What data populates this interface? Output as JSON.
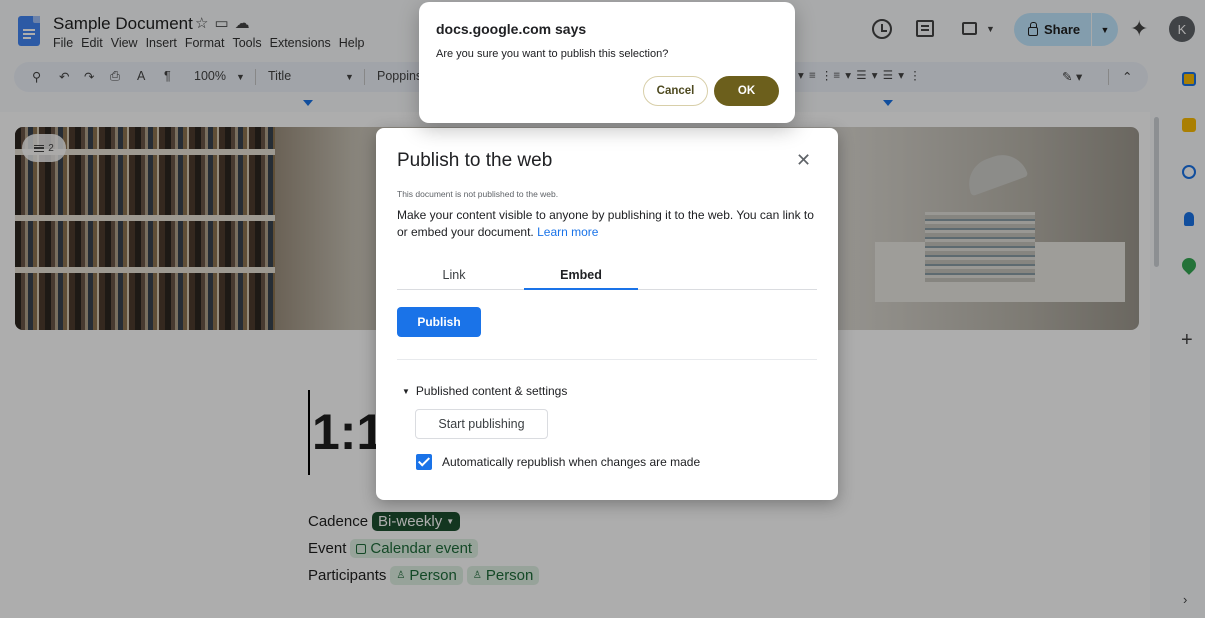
{
  "header": {
    "doc_title": "Sample Document",
    "menu": [
      "File",
      "Edit",
      "View",
      "Insert",
      "Format",
      "Tools",
      "Extensions",
      "Help"
    ],
    "share_label": "Share",
    "avatar_initial": "K"
  },
  "toolbar": {
    "zoom": "100%",
    "style": "Title",
    "font": "Poppins"
  },
  "document": {
    "outline_count": "2",
    "heading": "1:1",
    "cadence_label": "Cadence",
    "cadence_value": "Bi-weekly",
    "event_label": "Event",
    "event_value": "Calendar event",
    "participants_label": "Participants",
    "participants": [
      "Person",
      "Person"
    ]
  },
  "publish_dialog": {
    "title": "Publish to the web",
    "status": "This document is not published to the web.",
    "description": "Make your content visible to anyone by publishing it to the web. You can link to or embed your document.",
    "learn_more": "Learn more",
    "tabs": [
      "Link",
      "Embed"
    ],
    "active_tab": "Embed",
    "publish_button": "Publish",
    "section_title": "Published content & settings",
    "start_publishing": "Start publishing",
    "auto_republish": "Automatically republish when changes are made",
    "auto_republish_checked": true
  },
  "alert": {
    "title": "docs.google.com says",
    "message": "Are you sure you want to publish this selection?",
    "cancel": "Cancel",
    "ok": "OK"
  },
  "colors": {
    "accent": "#1a73e8",
    "share_bg": "#c2e7ff",
    "ok_button": "#6c5f1c",
    "chip_bg": "#dff0e3"
  }
}
